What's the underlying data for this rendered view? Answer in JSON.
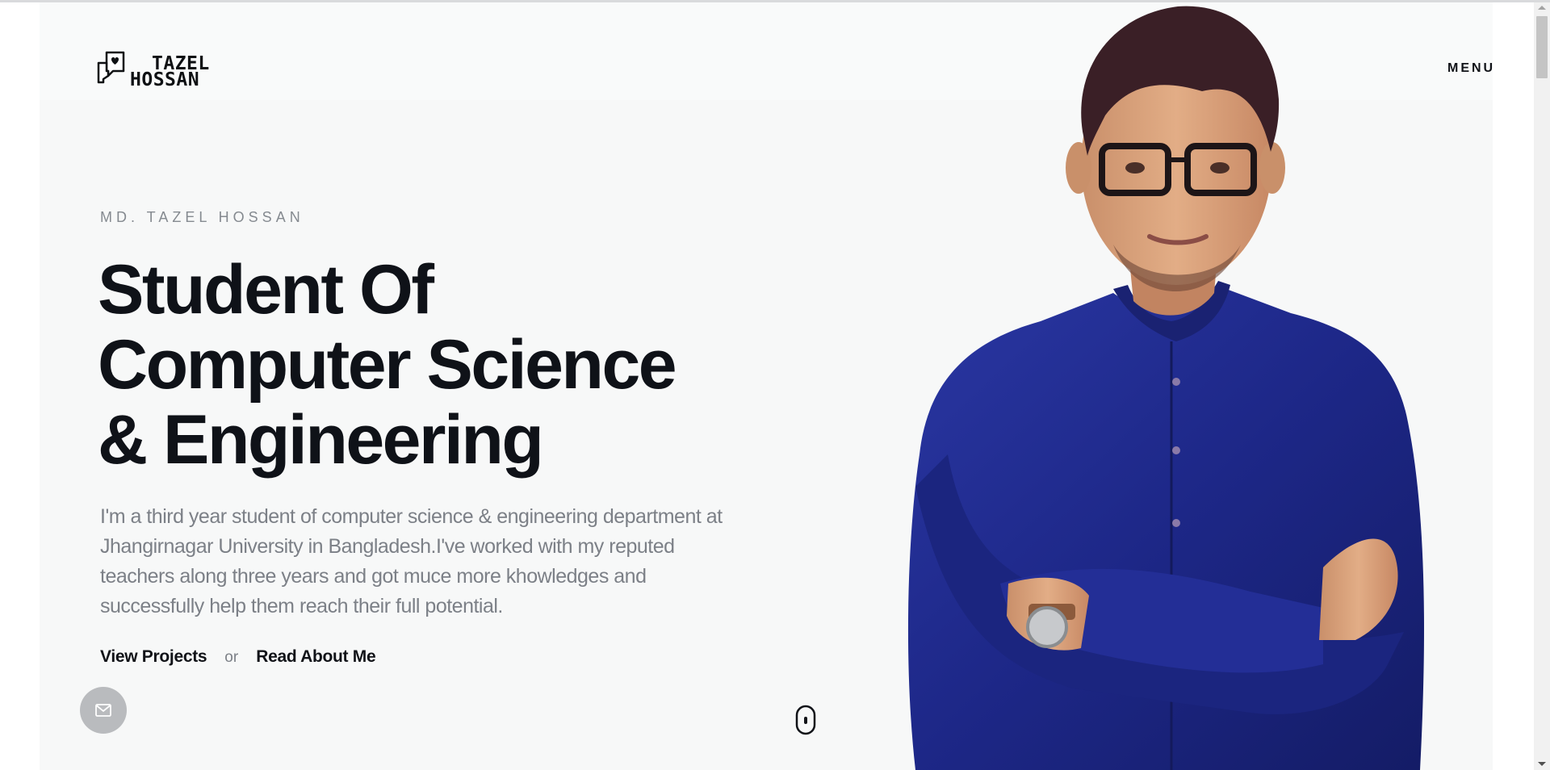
{
  "logo": {
    "line1": "TAZEL",
    "line2": "HOSSAN",
    "icon": "chat-bubbles-heart-icon"
  },
  "nav": {
    "menu_label": "MENU",
    "menu_icon": "hamburger-icon"
  },
  "hero": {
    "eyebrow": "MD. TAZEL HOSSAN",
    "headline_lines": [
      "Student Of",
      "Computer Science",
      "& Engineering"
    ],
    "intro": "I'm a third year student of computer science & engineering department at Jhangirnagar University in Bangladesh.I've worked with my reputed teachers along three years and got muce more khowledges and successfully help them reach their full potential.",
    "view_projects": "View Projects",
    "or": "or",
    "read_about": "Read About Me"
  },
  "contact": {
    "icon": "mail-icon"
  },
  "scroll": {
    "icon": "mouse-scroll-icon"
  },
  "portrait": {
    "icon": "portrait-photo"
  },
  "colors": {
    "background": "#f7f8f8",
    "text_dark": "#0f1218",
    "text_muted": "#7c8087",
    "shirt_blue": "#1f2b8c",
    "mail_button": "#b9bbbe"
  }
}
